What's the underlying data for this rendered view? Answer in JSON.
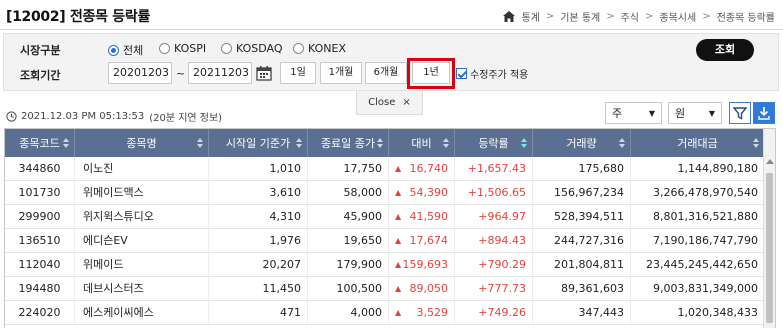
{
  "header": {
    "title": "[12002] 전종목 등락률",
    "breadcrumb": [
      "통계",
      "기본 통계",
      "주식",
      "종목시세",
      "전종목 등락률"
    ]
  },
  "filters": {
    "market_label": "시장구분",
    "market_options": [
      "전체",
      "KOSPI",
      "KOSDAQ",
      "KONEX"
    ],
    "market_selected": "전체",
    "period_label": "조회기간",
    "start_date": "20201203",
    "separator": "~",
    "end_date": "20211203",
    "period_buttons": [
      "1일",
      "1개월",
      "6개월",
      "1년"
    ],
    "period_highlighted": "1년",
    "adjusted_price_label": "수정주가 적용",
    "adjusted_price_checked": true,
    "search_label": "조회",
    "close_label": "Close",
    "close_icon": "×"
  },
  "info": {
    "timestamp": "2021.12.03 PM 05:13:53",
    "delay_note": "(20분 지연 정보)"
  },
  "controls": {
    "unit1": "주",
    "unit2": "원"
  },
  "table": {
    "columns": [
      "종목코드",
      "종목명",
      "시작일 기준가",
      "종료일 종가",
      "대비",
      "등락률",
      "거래량",
      "거래대금"
    ],
    "rows": [
      [
        "344860",
        "이노진",
        "1,010",
        "17,750",
        "16,740",
        "+1,657.43",
        "175,680",
        "1,144,890,180"
      ],
      [
        "101730",
        "위메이드맥스",
        "3,610",
        "58,000",
        "54,390",
        "+1,506.65",
        "156,967,234",
        "3,266,478,970,540"
      ],
      [
        "299900",
        "위지윅스튜디오",
        "4,310",
        "45,900",
        "41,590",
        "+964.97",
        "528,394,511",
        "8,801,316,521,880"
      ],
      [
        "136510",
        "에디슨EV",
        "1,976",
        "19,650",
        "17,674",
        "+894.43",
        "244,727,316",
        "7,190,186,747,790"
      ],
      [
        "112040",
        "위메이드",
        "20,207",
        "179,900",
        "159,693",
        "+790.29",
        "201,804,811",
        "23,445,245,442,650"
      ],
      [
        "194480",
        "데브시스터즈",
        "11,450",
        "100,500",
        "89,050",
        "+777.73",
        "89,361,603",
        "9,003,831,349,000"
      ],
      [
        "224020",
        "에스케이씨에스",
        "471",
        "4,000",
        "3,529",
        "+749.26",
        "347,443",
        "1,020,348,433"
      ]
    ]
  },
  "colors": {
    "header_bg": "#5a6f92",
    "up_red": "#e8423d",
    "accent_blue": "#2a6fd6",
    "highlight": "#d9000f"
  },
  "icons": {
    "home": "home-icon",
    "calendar": "calendar-icon",
    "clock": "clock-icon",
    "filter": "filter-icon",
    "download": "download-icon",
    "sort": "sort-icon",
    "up": "up-triangle-icon"
  }
}
